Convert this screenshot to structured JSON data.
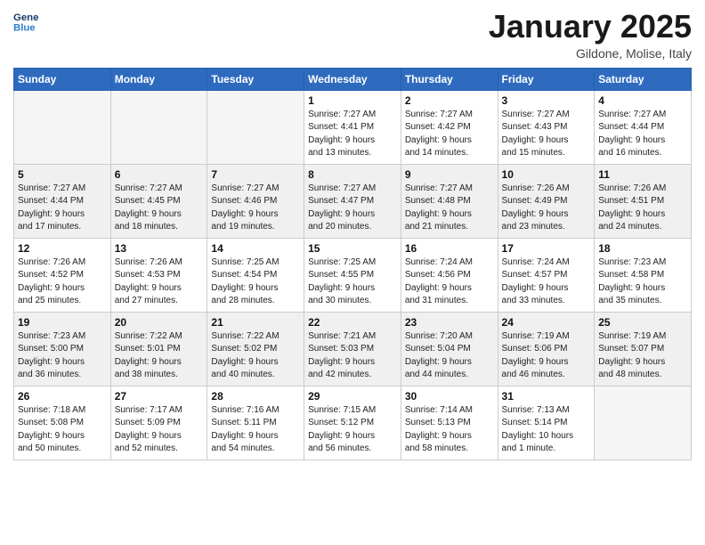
{
  "logo": {
    "line1": "General",
    "line2": "Blue"
  },
  "title": "January 2025",
  "subtitle": "Gildone, Molise, Italy",
  "weekdays": [
    "Sunday",
    "Monday",
    "Tuesday",
    "Wednesday",
    "Thursday",
    "Friday",
    "Saturday"
  ],
  "weeks": [
    [
      {
        "day": "",
        "detail": ""
      },
      {
        "day": "",
        "detail": ""
      },
      {
        "day": "",
        "detail": ""
      },
      {
        "day": "1",
        "detail": "Sunrise: 7:27 AM\nSunset: 4:41 PM\nDaylight: 9 hours\nand 13 minutes."
      },
      {
        "day": "2",
        "detail": "Sunrise: 7:27 AM\nSunset: 4:42 PM\nDaylight: 9 hours\nand 14 minutes."
      },
      {
        "day": "3",
        "detail": "Sunrise: 7:27 AM\nSunset: 4:43 PM\nDaylight: 9 hours\nand 15 minutes."
      },
      {
        "day": "4",
        "detail": "Sunrise: 7:27 AM\nSunset: 4:44 PM\nDaylight: 9 hours\nand 16 minutes."
      }
    ],
    [
      {
        "day": "5",
        "detail": "Sunrise: 7:27 AM\nSunset: 4:44 PM\nDaylight: 9 hours\nand 17 minutes."
      },
      {
        "day": "6",
        "detail": "Sunrise: 7:27 AM\nSunset: 4:45 PM\nDaylight: 9 hours\nand 18 minutes."
      },
      {
        "day": "7",
        "detail": "Sunrise: 7:27 AM\nSunset: 4:46 PM\nDaylight: 9 hours\nand 19 minutes."
      },
      {
        "day": "8",
        "detail": "Sunrise: 7:27 AM\nSunset: 4:47 PM\nDaylight: 9 hours\nand 20 minutes."
      },
      {
        "day": "9",
        "detail": "Sunrise: 7:27 AM\nSunset: 4:48 PM\nDaylight: 9 hours\nand 21 minutes."
      },
      {
        "day": "10",
        "detail": "Sunrise: 7:26 AM\nSunset: 4:49 PM\nDaylight: 9 hours\nand 23 minutes."
      },
      {
        "day": "11",
        "detail": "Sunrise: 7:26 AM\nSunset: 4:51 PM\nDaylight: 9 hours\nand 24 minutes."
      }
    ],
    [
      {
        "day": "12",
        "detail": "Sunrise: 7:26 AM\nSunset: 4:52 PM\nDaylight: 9 hours\nand 25 minutes."
      },
      {
        "day": "13",
        "detail": "Sunrise: 7:26 AM\nSunset: 4:53 PM\nDaylight: 9 hours\nand 27 minutes."
      },
      {
        "day": "14",
        "detail": "Sunrise: 7:25 AM\nSunset: 4:54 PM\nDaylight: 9 hours\nand 28 minutes."
      },
      {
        "day": "15",
        "detail": "Sunrise: 7:25 AM\nSunset: 4:55 PM\nDaylight: 9 hours\nand 30 minutes."
      },
      {
        "day": "16",
        "detail": "Sunrise: 7:24 AM\nSunset: 4:56 PM\nDaylight: 9 hours\nand 31 minutes."
      },
      {
        "day": "17",
        "detail": "Sunrise: 7:24 AM\nSunset: 4:57 PM\nDaylight: 9 hours\nand 33 minutes."
      },
      {
        "day": "18",
        "detail": "Sunrise: 7:23 AM\nSunset: 4:58 PM\nDaylight: 9 hours\nand 35 minutes."
      }
    ],
    [
      {
        "day": "19",
        "detail": "Sunrise: 7:23 AM\nSunset: 5:00 PM\nDaylight: 9 hours\nand 36 minutes."
      },
      {
        "day": "20",
        "detail": "Sunrise: 7:22 AM\nSunset: 5:01 PM\nDaylight: 9 hours\nand 38 minutes."
      },
      {
        "day": "21",
        "detail": "Sunrise: 7:22 AM\nSunset: 5:02 PM\nDaylight: 9 hours\nand 40 minutes."
      },
      {
        "day": "22",
        "detail": "Sunrise: 7:21 AM\nSunset: 5:03 PM\nDaylight: 9 hours\nand 42 minutes."
      },
      {
        "day": "23",
        "detail": "Sunrise: 7:20 AM\nSunset: 5:04 PM\nDaylight: 9 hours\nand 44 minutes."
      },
      {
        "day": "24",
        "detail": "Sunrise: 7:19 AM\nSunset: 5:06 PM\nDaylight: 9 hours\nand 46 minutes."
      },
      {
        "day": "25",
        "detail": "Sunrise: 7:19 AM\nSunset: 5:07 PM\nDaylight: 9 hours\nand 48 minutes."
      }
    ],
    [
      {
        "day": "26",
        "detail": "Sunrise: 7:18 AM\nSunset: 5:08 PM\nDaylight: 9 hours\nand 50 minutes."
      },
      {
        "day": "27",
        "detail": "Sunrise: 7:17 AM\nSunset: 5:09 PM\nDaylight: 9 hours\nand 52 minutes."
      },
      {
        "day": "28",
        "detail": "Sunrise: 7:16 AM\nSunset: 5:11 PM\nDaylight: 9 hours\nand 54 minutes."
      },
      {
        "day": "29",
        "detail": "Sunrise: 7:15 AM\nSunset: 5:12 PM\nDaylight: 9 hours\nand 56 minutes."
      },
      {
        "day": "30",
        "detail": "Sunrise: 7:14 AM\nSunset: 5:13 PM\nDaylight: 9 hours\nand 58 minutes."
      },
      {
        "day": "31",
        "detail": "Sunrise: 7:13 AM\nSunset: 5:14 PM\nDaylight: 10 hours\nand 1 minute."
      },
      {
        "day": "",
        "detail": ""
      }
    ]
  ]
}
